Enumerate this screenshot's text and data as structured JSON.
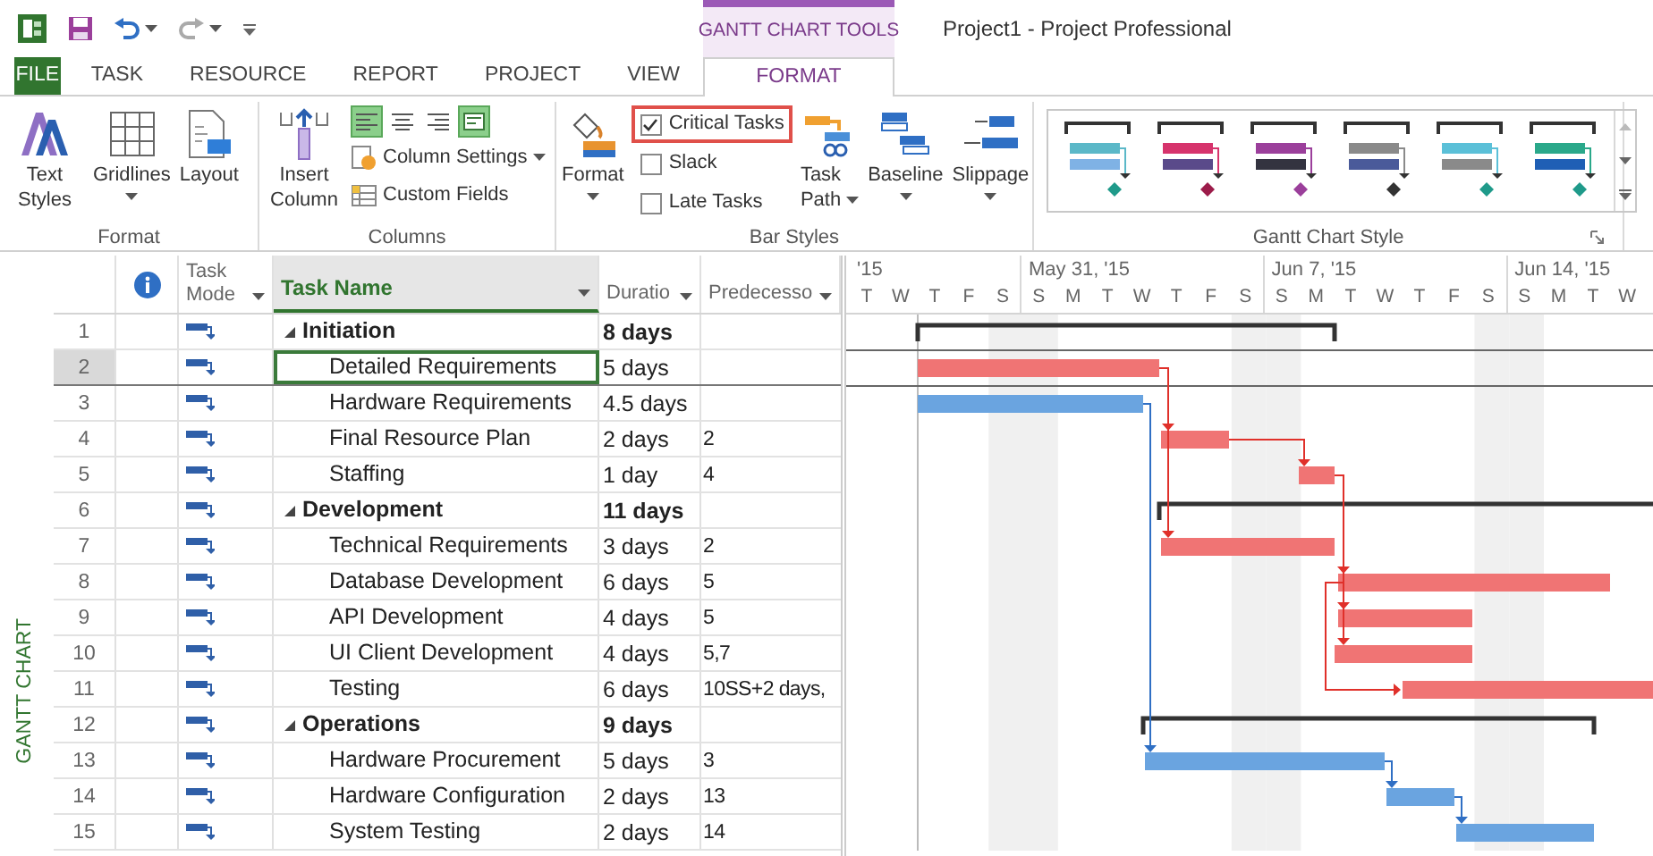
{
  "window": {
    "title": "Project1 - Project Professional"
  },
  "contextual_tab": {
    "label": "GANTT CHART TOOLS"
  },
  "tabs": [
    {
      "label": "FILE",
      "kind": "file",
      "selected": false
    },
    {
      "label": "TASK",
      "kind": "normal",
      "selected": false
    },
    {
      "label": "RESOURCE",
      "kind": "normal",
      "selected": false
    },
    {
      "label": "REPORT",
      "kind": "normal",
      "selected": false
    },
    {
      "label": "PROJECT",
      "kind": "normal",
      "selected": false
    },
    {
      "label": "VIEW",
      "kind": "normal",
      "selected": false
    },
    {
      "label": "FORMAT",
      "kind": "contextual",
      "selected": true
    }
  ],
  "ribbon": {
    "groups": [
      {
        "label": "Format",
        "items": [
          {
            "kind": "large",
            "label": "Text Styles",
            "dropdown": false
          },
          {
            "kind": "large",
            "label": "Gridlines",
            "dropdown": true
          },
          {
            "kind": "large",
            "label": "Layout",
            "dropdown": false
          }
        ]
      },
      {
        "label": "Columns",
        "items": [
          {
            "kind": "large",
            "label": "Insert Column",
            "dropdown": false
          },
          {
            "kind": "align",
            "buttons": [
              {
                "selected": true
              },
              {
                "selected": false
              },
              {
                "selected": false
              },
              {
                "selected": true
              }
            ]
          },
          {
            "kind": "small",
            "label": "Column Settings",
            "dropdown": true
          },
          {
            "kind": "small",
            "label": "Custom Fields",
            "dropdown": false
          }
        ]
      },
      {
        "label": "Bar Styles",
        "items": [
          {
            "kind": "large",
            "label": "Format",
            "dropdown": true
          },
          {
            "kind": "checkbox",
            "label": "Critical Tasks",
            "checked": true,
            "highlighted": true
          },
          {
            "kind": "checkbox",
            "label": "Slack",
            "checked": false,
            "highlighted": false
          },
          {
            "kind": "checkbox",
            "label": "Late Tasks",
            "checked": false,
            "highlighted": false
          },
          {
            "kind": "large",
            "label": "Task Path",
            "dropdown": true
          },
          {
            "kind": "large",
            "label": "Baseline",
            "dropdown": true
          },
          {
            "kind": "large",
            "label": "Slippage",
            "dropdown": true
          }
        ]
      },
      {
        "label": "Gantt Chart Style",
        "items": [
          {
            "kind": "gallery",
            "swatches": [
              {
                "task_bar": {
                  "color": "#5bb8c8"
                },
                "base_bar": {
                  "color": "#7fb2e5"
                },
                "milestone": {
                  "color": "#1f9a8a"
                }
              },
              {
                "task_bar": {
                  "color": "#d6336c"
                },
                "base_bar": {
                  "color": "#5a4a8a"
                },
                "milestone": {
                  "color": "#9c1c4a"
                }
              },
              {
                "task_bar": {
                  "color": "#9b3f9b"
                },
                "base_bar": {
                  "color": "#333340"
                },
                "milestone": {
                  "color": "#9b3f9b"
                }
              },
              {
                "task_bar": {
                  "color": "#8a8a8a"
                },
                "base_bar": {
                  "color": "#4a5a9a"
                },
                "milestone": {
                  "color": "#333333"
                }
              },
              {
                "task_bar": {
                  "color": "#5bc0d8"
                },
                "base_bar": {
                  "color": "#8a8a8a"
                },
                "milestone": {
                  "color": "#1f9a8a"
                }
              },
              {
                "task_bar": {
                  "color": "#2aa88a"
                },
                "base_bar": {
                  "color": "#1f5fb5"
                },
                "milestone": {
                  "color": "#1f9a8a"
                }
              }
            ]
          }
        ]
      }
    ]
  },
  "view_label": "GANTT CHART",
  "table": {
    "columns": [
      {
        "label": "Task Mode",
        "filter": true,
        "selected": false
      },
      {
        "label": "Task Name",
        "filter": true,
        "selected": true
      },
      {
        "label": "Duratio",
        "filter": true,
        "selected": false
      },
      {
        "label": "Predecesso",
        "filter": true,
        "selected": false
      }
    ],
    "rows": [
      {
        "id": "1",
        "name": "Initiation",
        "duration": "8 days",
        "kind": "summary",
        "expanded": true,
        "selected": false
      },
      {
        "id": "2",
        "name": "Detailed Requirements",
        "duration": "5 days",
        "kind": "task",
        "critical": true,
        "selected": true
      },
      {
        "id": "3",
        "name": "Hardware Requirements",
        "duration": "4.5 days",
        "kind": "task",
        "critical": false,
        "selected": false
      },
      {
        "id": "4",
        "name": "Final Resource Plan",
        "duration": "2 days",
        "predecessors": "2",
        "kind": "task",
        "critical": true,
        "selected": false
      },
      {
        "id": "5",
        "name": "Staffing",
        "duration": "1 day",
        "predecessors": "4",
        "kind": "task",
        "critical": true,
        "selected": false
      },
      {
        "id": "6",
        "name": "Development",
        "duration": "11 days",
        "kind": "summary",
        "expanded": true,
        "selected": false
      },
      {
        "id": "7",
        "name": "Technical Requirements",
        "duration": "3 days",
        "predecessors": "2",
        "kind": "task",
        "critical": true,
        "selected": false
      },
      {
        "id": "8",
        "name": "Database Development",
        "duration": "6 days",
        "predecessors": "5",
        "kind": "task",
        "critical": true,
        "selected": false
      },
      {
        "id": "9",
        "name": "API Development",
        "duration": "4 days",
        "predecessors": "5",
        "kind": "task",
        "critical": true,
        "selected": false
      },
      {
        "id": "10",
        "name": "UI Client Development",
        "duration": "4 days",
        "predecessors": "5,7",
        "kind": "task",
        "critical": true,
        "selected": false
      },
      {
        "id": "11",
        "name": "Testing",
        "duration": "6 days",
        "predecessors": "10SS+2 days,",
        "kind": "task",
        "critical": true,
        "selected": false
      },
      {
        "id": "12",
        "name": "Operations",
        "duration": "9 days",
        "kind": "summary",
        "expanded": true,
        "selected": false
      },
      {
        "id": "13",
        "name": "Hardware Procurement",
        "duration": "5 days",
        "predecessors": "3",
        "kind": "task",
        "critical": false,
        "selected": false
      },
      {
        "id": "14",
        "name": "Hardware Configuration",
        "duration": "2 days",
        "predecessors": "13",
        "kind": "task",
        "critical": false,
        "selected": false
      },
      {
        "id": "15",
        "name": "System Testing",
        "duration": "2 days",
        "predecessors": "14",
        "kind": "task",
        "critical": false,
        "selected": false
      }
    ]
  },
  "timescale": {
    "weeks": [
      {
        "label": "'15",
        "days": [
          "T",
          "W",
          "T",
          "F",
          "S"
        ]
      },
      {
        "label": "May 31, '15",
        "days": [
          "S",
          "M",
          "T",
          "W",
          "T",
          "F",
          "S"
        ]
      },
      {
        "label": "Jun 7, '15",
        "days": [
          "S",
          "M",
          "T",
          "W",
          "T",
          "F",
          "S"
        ]
      },
      {
        "label": "Jun 14, '15",
        "days": [
          "S",
          "M",
          "T",
          "W"
        ]
      }
    ]
  }
}
